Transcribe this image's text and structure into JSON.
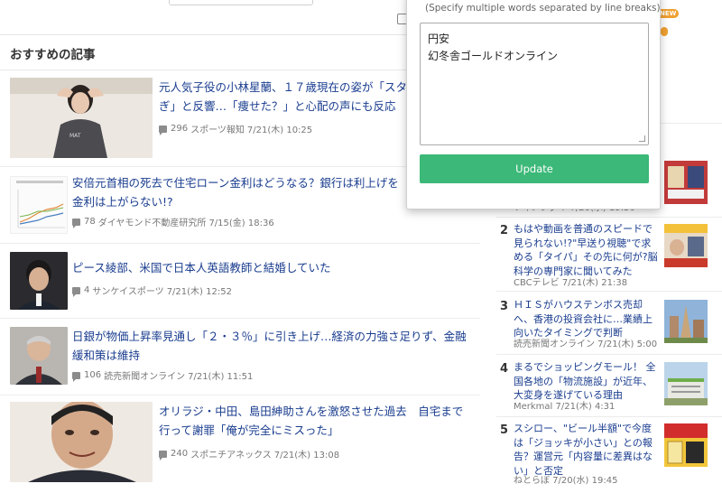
{
  "popup": {
    "hint": "(Specify multiple words separated by line breaks)",
    "words": [
      "円安",
      "幻冬舎ゴールドオンライン"
    ],
    "update_label": "Update"
  },
  "badge_new": "NEW",
  "recommended": {
    "title": "おすすめの記事",
    "articles": [
      {
        "title_line1": "元人気子役の小林星蘭、１７歳現在の姿が「スタ",
        "title_line2": "ぎ」と反響…「痩せた？」と心配の声にも反応",
        "comments": "296",
        "source": "スポーツ報知",
        "date": "7/21(木) 10:25"
      },
      {
        "title_line1": "安倍元首相の死去で住宅ローン金利はどうなる？銀行は利上げを",
        "title_line2": "金利は上がらない!?",
        "comments": "78",
        "source": "ダイヤモンド不動産研究所",
        "date": "7/15(金) 18:36"
      },
      {
        "title_line1": "ピース綾部、米国で日本人英語教師と結婚していた",
        "title_line2": "",
        "comments": "4",
        "source": "サンケイスポーツ",
        "date": "7/21(木) 12:52"
      },
      {
        "title_line1": "日銀が物価上昇率見通し「２・３％」に引き上げ…経済の力強さ足りず、金融",
        "title_line2": "緩和策は維持",
        "comments": "106",
        "source": "読売新聞オンライン",
        "date": "7/21(木) 11:51"
      },
      {
        "title_line1": "オリラジ・中田、島田紳助さんを激怒させた過去　自宅まで",
        "title_line2": "行って謝罪「俺が完全にミスった」",
        "comments": "240",
        "source": "スポニチアネックス",
        "date": "7/21(木) 13:08"
      }
    ]
  },
  "ranking": {
    "top_meta": "ツギノジダイ 7/20(水) 19:50",
    "items": [
      {
        "rank": "2",
        "title": "もはや動画を普通のスピードで見られない!?\"早送り視聴\"で求める「タイパ」その先に何が?脳科学の専門家に聞いてみた",
        "meta": "CBCテレビ 7/21(木) 21:38"
      },
      {
        "rank": "3",
        "title": "ＨＩＳがハウステンボス売却へ、香港の投資会社に…業績上向いたタイミングで判断",
        "meta": "読売新聞オンライン 7/21(木) 5:00"
      },
      {
        "rank": "4",
        "title": "まるでショッピングモール！ 全国各地の「物流施設」が近年、大変身を遂げている理由",
        "meta": "Merkmal 7/21(木) 4:31"
      },
      {
        "rank": "5",
        "title": "スシロー、\"ビール半額\"で今度は「ジョッキが小さい」との報告？運営元「内容量に差異はない」と否定",
        "meta": "ねとらぼ 7/20(水) 19:45"
      }
    ]
  },
  "colors": {
    "link": "#1a3d8f",
    "update_button": "#3cb878",
    "badge": "#f0a030"
  }
}
